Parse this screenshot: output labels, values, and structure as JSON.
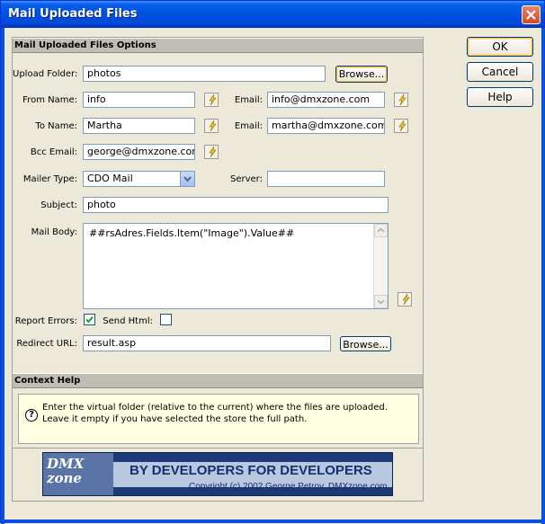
{
  "window": {
    "title": "Mail Uploaded Files"
  },
  "sections": {
    "options_title": "Mail Uploaded Files Options",
    "help_title": "Context Help"
  },
  "form": {
    "upload_folder": {
      "label": "Upload Folder:",
      "value": "photos",
      "browse": "Browse..."
    },
    "from_name": {
      "label": "From Name:",
      "value": "info"
    },
    "from_email": {
      "label": "Email:",
      "value": "info@dmxzone.com"
    },
    "to_name": {
      "label": "To Name:",
      "value": "Martha"
    },
    "to_email": {
      "label": "Email:",
      "value": "martha@dmxzone.com"
    },
    "bcc_email": {
      "label": "Bcc Email:",
      "value": "george@dmxzone.com"
    },
    "mailer_type": {
      "label": "Mailer Type:",
      "value": "CDO Mail"
    },
    "server": {
      "label": "Server:",
      "value": ""
    },
    "subject": {
      "label": "Subject:",
      "value": "photo"
    },
    "mail_body": {
      "label": "Mail Body:",
      "value": "##rsAdres.Fields.Item(\"Image\").Value##"
    },
    "report_errors": {
      "label": "Report Errors:",
      "checked": true
    },
    "send_html": {
      "label": "Send Html:",
      "checked": false
    },
    "redirect_url": {
      "label": "Redirect URL:",
      "value": "result.asp",
      "browse": "Browse..."
    }
  },
  "context_help": {
    "text": "Enter the virtual folder (relative to the current) where the files are uploaded. Leave it empty if you have selected the store the full path.",
    "icon": "?"
  },
  "banner": {
    "logo": "DMX zone",
    "slogan": "BY DEVELOPERS FOR DEVELOPERS",
    "copyright": "Copyright (c) 2002 George Petrov, DMXzone.com"
  },
  "buttons": {
    "ok": "OK",
    "cancel": "Cancel",
    "help": "Help"
  }
}
